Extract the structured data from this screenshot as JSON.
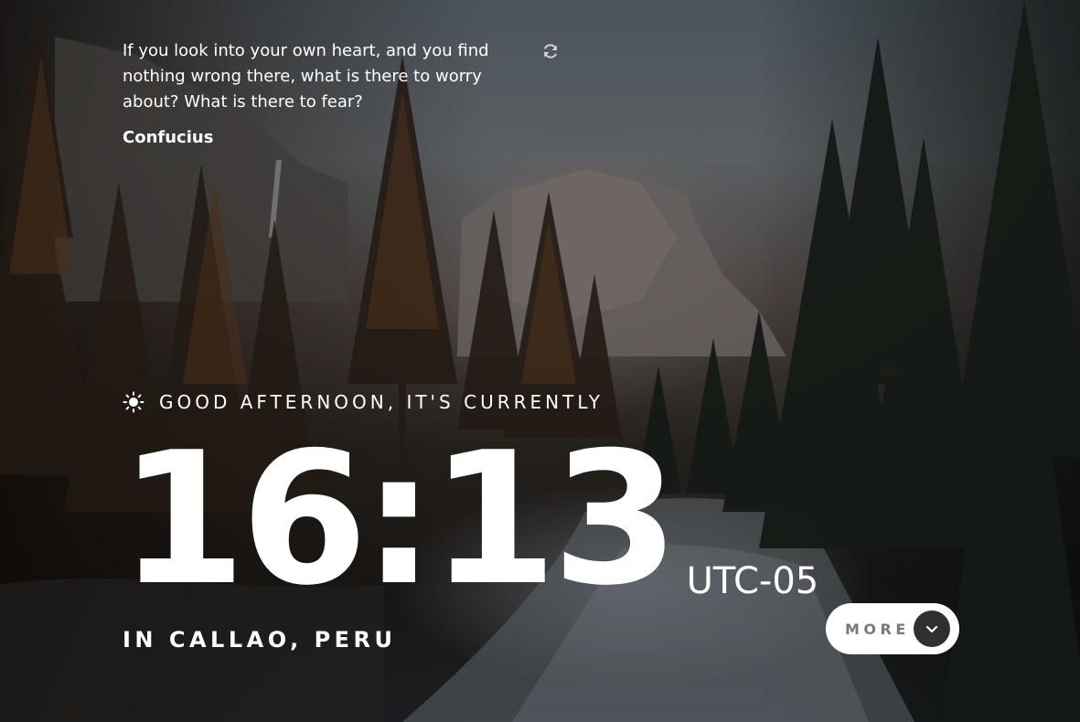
{
  "quote": {
    "text": "If you look into your own heart, and you find nothing wrong there, what is there to worry about? What is there to fear?",
    "author": "Confucius",
    "refresh_icon": "refresh-icon"
  },
  "greeting": {
    "icon": "sun-icon",
    "text": "GOOD AFTERNOON, IT'S CURRENTLY"
  },
  "clock": {
    "time": "16:13",
    "timezone": "UTC-05"
  },
  "location": {
    "text": "IN CALLAO, PERU"
  },
  "more_button": {
    "label": "MORE",
    "icon": "chevron-down-icon"
  },
  "colors": {
    "text": "#ffffff",
    "button_bg": "#ffffff",
    "button_label": "#7a7a7a",
    "chevron_bg": "#303030"
  }
}
